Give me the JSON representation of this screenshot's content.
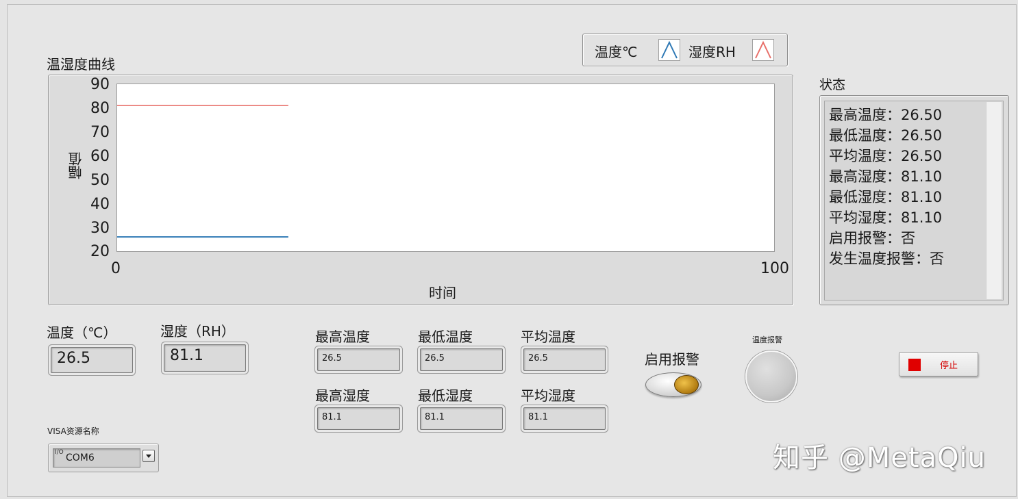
{
  "chart_data": {
    "type": "line",
    "title": "温湿度曲线",
    "xlabel": "时间",
    "ylabel": "幅值",
    "xlim": [
      0,
      100
    ],
    "ylim": [
      20,
      90
    ],
    "x_ticks": [
      "0",
      "100"
    ],
    "y_ticks": [
      "90",
      "80",
      "70",
      "60",
      "50",
      "40",
      "30",
      "20"
    ],
    "legend_position": "top-right",
    "series": [
      {
        "name": "温度℃",
        "color": "#2f79b5",
        "x": [
          0,
          26
        ],
        "y": [
          26.5,
          26.5
        ]
      },
      {
        "name": "湿度RH",
        "color": "#e8706a",
        "x": [
          0,
          26
        ],
        "y": [
          81.1,
          81.1
        ]
      }
    ]
  },
  "status": {
    "title": "状态",
    "lines": [
      "最高温度：26.50",
      "最低温度：26.50",
      "平均温度：26.50",
      "最高湿度：81.10",
      "最低湿度：81.10",
      "平均湿度：81.10",
      "启用报警：否",
      "发生温度报警：否"
    ]
  },
  "readings": {
    "temp_label": "温度（℃）",
    "temp_value": "26.5",
    "hum_label": "湿度（RH）",
    "hum_value": "81.1"
  },
  "stats": {
    "max_temp_label": "最高温度",
    "max_temp_value": "26.5",
    "min_temp_label": "最低温度",
    "min_temp_value": "26.5",
    "avg_temp_label": "平均温度",
    "avg_temp_value": "26.5",
    "max_hum_label": "最高湿度",
    "max_hum_value": "81.1",
    "min_hum_label": "最低湿度",
    "min_hum_value": "81.1",
    "avg_hum_label": "平均湿度",
    "avg_hum_value": "81.1"
  },
  "alarm": {
    "enable_label": "启用报警",
    "enable_on": false,
    "led_label": "温度报警",
    "led_on": false
  },
  "stop_button": {
    "label": "停止",
    "color": "#e00000"
  },
  "visa": {
    "label": "VISA资源名称",
    "io_glyph": "I/O",
    "value": "COM6"
  },
  "watermark": "知乎 @MetaQiu"
}
